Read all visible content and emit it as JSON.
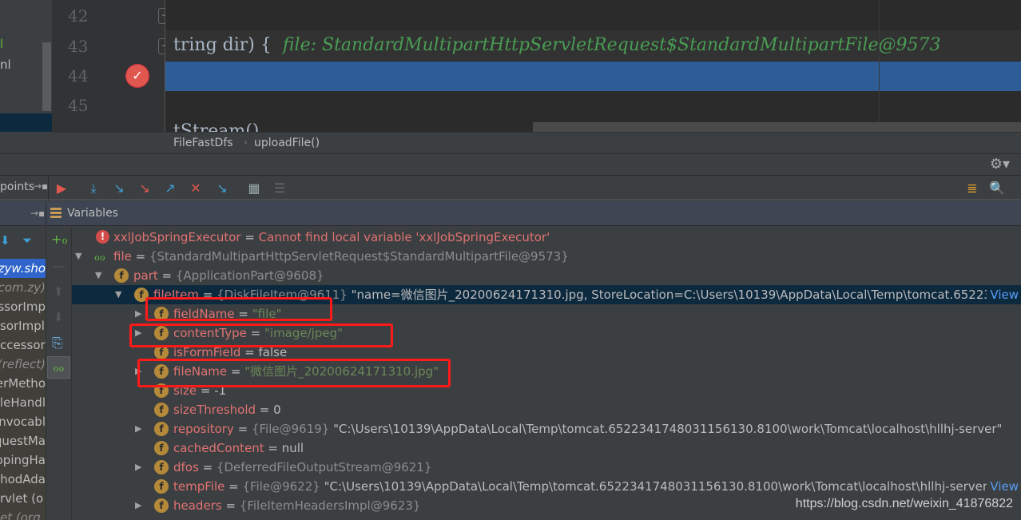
{
  "project_pane": {
    "items": [
      {
        "label": "l"
      },
      {
        "label": "nl"
      }
    ]
  },
  "editor": {
    "line_numbers": [
      "42",
      "43",
      "44",
      "45"
    ],
    "code_line_43": "tring dir) {",
    "inline_hint": "file: StandardMultipartHttpServletRequest$StandardMultipartFile@9573",
    "code_line_46": "tStream()"
  },
  "breadcrumb": {
    "items": [
      "FileFastDfs",
      "uploadFile()"
    ],
    "separator": "›"
  },
  "debug_toolbar": {
    "left_label": "points",
    "buttons": [
      "show-execution-point",
      "step-over",
      "step-into",
      "force-step-into",
      "step-out",
      "drop-frame",
      "run-to-cursor",
      "evaluate-expression",
      "trace"
    ]
  },
  "variables_header": {
    "label": "Variables"
  },
  "frames": [
    {
      "label": "zyw.sho",
      "selected": true
    },
    {
      "label": "(com.zy",
      "italic": true
    },
    {
      "label": "essorImp"
    },
    {
      "label": "sorImpl"
    },
    {
      "label": "ccessor"
    },
    {
      "label": "(reflect)",
      "italic": true
    },
    {
      "label": "erMetho"
    },
    {
      "label": "leHandl"
    },
    {
      "label": "nvocabl"
    },
    {
      "label": "questMa"
    },
    {
      "label": "ppingHa"
    },
    {
      "label": "thodAda"
    },
    {
      "label": "rvlet (o"
    },
    {
      "label": "et (org"
    }
  ],
  "variables": [
    {
      "name": "xxlJobSpringExecutor",
      "eq": " = ",
      "error": "Cannot find local variable 'xxlJobSpringExecutor'"
    },
    {
      "name": "file",
      "eq": " = ",
      "type": "{StandardMultipartHttpServletRequest$StandardMultipartFile@9573}"
    },
    {
      "name": "part",
      "eq": " = ",
      "type": "{ApplicationPart@9608}"
    },
    {
      "name": "fileItem",
      "eq": " = ",
      "type": "{DiskFileItem@9611}",
      "value": " \"name=微信图片_20200624171310.jpg, StoreLocation=C:\\Users\\10139\\AppData\\Local\\Temp\\tomcat.652234174€...",
      "view": " View"
    },
    {
      "name": "fieldName",
      "eq": " = ",
      "str": "\"file\""
    },
    {
      "name": "contentType",
      "eq": " = ",
      "str": "\"image/jpeg\""
    },
    {
      "name": "isFormField",
      "eq": " = ",
      "value": "false"
    },
    {
      "name": "fileName",
      "eq": " = ",
      "str": "\"微信图片_20200624171310.jpg\""
    },
    {
      "name": "size",
      "eq": " = ",
      "value": "-1"
    },
    {
      "name": "sizeThreshold",
      "eq": " = ",
      "value": "0"
    },
    {
      "name": "repository",
      "eq": " = ",
      "type": "{File@9619}",
      "value": " \"C:\\Users\\10139\\AppData\\Local\\Temp\\tomcat.6522341748031156130.8100\\work\\Tomcat\\localhost\\hllhj-server\""
    },
    {
      "name": "cachedContent",
      "eq": " = ",
      "value": "null"
    },
    {
      "name": "dfos",
      "eq": " = ",
      "type": "{DeferredFileOutputStream@9621}"
    },
    {
      "name": "tempFile",
      "eq": " = ",
      "type": "{File@9622}",
      "value": " \"C:\\Users\\10139\\AppData\\Local\\Temp\\tomcat.6522341748031156130.8100\\work\\Tomcat\\localhost\\hllhj-server\\uplc...",
      "view": " View"
    },
    {
      "name": "headers",
      "eq": " = ",
      "type": "{FileItemHeadersImpl@9623}"
    }
  ],
  "watermark": "https://blog.csdn.net/weixin_41876822",
  "colors": {
    "highlight": "#2d5c96",
    "selected_row": "#0d293e",
    "annotation_box": "#ff1a1a",
    "var_name": "#e17272",
    "string": "#6a8759"
  }
}
